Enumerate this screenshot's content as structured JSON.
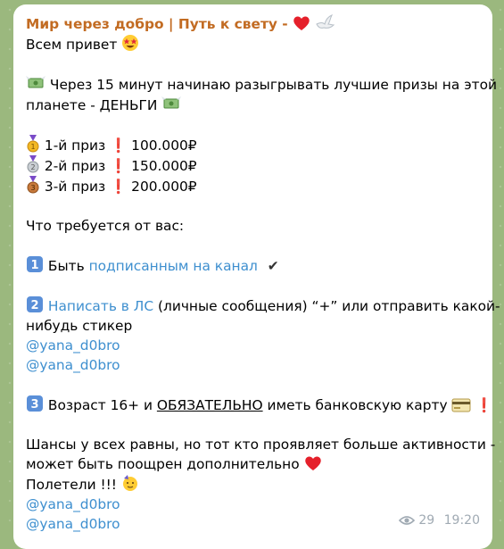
{
  "message": {
    "sender": "Мир через добро | Путь к свету -",
    "greeting": "Всем привет",
    "intro_1": "Через 15 минут начинаю разыгрывать лучшие призы на этой",
    "intro_2": "планете - ДЕНЬГИ",
    "prizes": [
      {
        "label": "1-й приз",
        "amount": "100.000₽"
      },
      {
        "label": "2-й приз",
        "amount": "150.000₽"
      },
      {
        "label": "3-й приз",
        "amount": "200.000₽"
      }
    ],
    "requirements_title": "Что требуется от вас:",
    "req1_prefix": "Быть",
    "req1_link": "подписанным на канал",
    "req2_link": "Написать в ЛС",
    "req2_rest": "(личные сообщения) “+” или отправить какой-",
    "req2_cont": "нибудь стикер",
    "handle": "@yana_d0bro",
    "req3_prefix": "Возраст 16+ и",
    "req3_emph": "ОБЯЗАТЕЛЬНО",
    "req3_suffix": "иметь банковскую карту",
    "chances_1": "Шансы у всех равны, но тот кто проявляет больше активности -",
    "chances_2": "может быть поощрен дополнительно",
    "go": "Полетели !!!",
    "views": "29",
    "time": "19:20"
  }
}
